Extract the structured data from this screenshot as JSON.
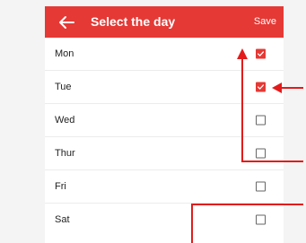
{
  "colors": {
    "accent": "#e53935",
    "annotation": "#e31b1b"
  },
  "header": {
    "title": "Select the day",
    "save_label": "Save",
    "back_icon": "arrow-left-icon"
  },
  "days": [
    {
      "label": "Mon",
      "checked": true
    },
    {
      "label": "Tue",
      "checked": true
    },
    {
      "label": "Wed",
      "checked": false
    },
    {
      "label": "Thur",
      "checked": false
    },
    {
      "label": "Fri",
      "checked": false
    },
    {
      "label": "Sat",
      "checked": false
    }
  ]
}
